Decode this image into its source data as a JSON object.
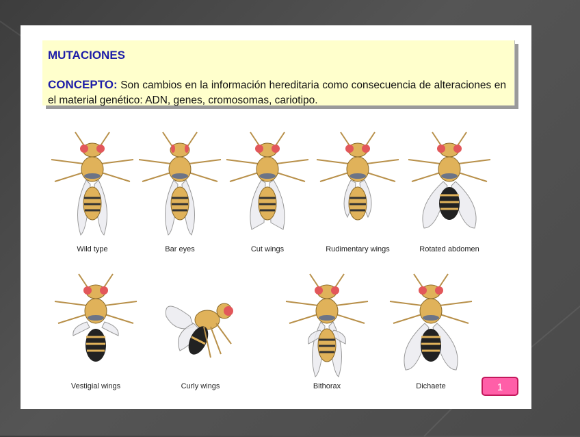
{
  "heading": "MUTACIONES",
  "concept": {
    "keyword": "CONCEPTO:",
    "text": "Son cambios en la información hereditaria como consecuencia de alteraciones en el material genético: ADN, genes, cromosomas, cariotipo."
  },
  "flies": [
    {
      "label": "Wild type"
    },
    {
      "label": "Bar eyes"
    },
    {
      "label": "Cut wings"
    },
    {
      "label": "Rudimentary wings"
    },
    {
      "label": "Rotated abdomen"
    },
    {
      "label": "Vestigial wings"
    },
    {
      "label": "Curly wings"
    },
    {
      "label": "Bithorax"
    },
    {
      "label": "Dichaete"
    }
  ],
  "page_number": "1",
  "colors": {
    "title": "#1d1da8",
    "banner": "#ffffcc",
    "page_button": "#ff5fa8",
    "fly_body": "#e0b25a",
    "fly_eye": "#e2575a"
  }
}
